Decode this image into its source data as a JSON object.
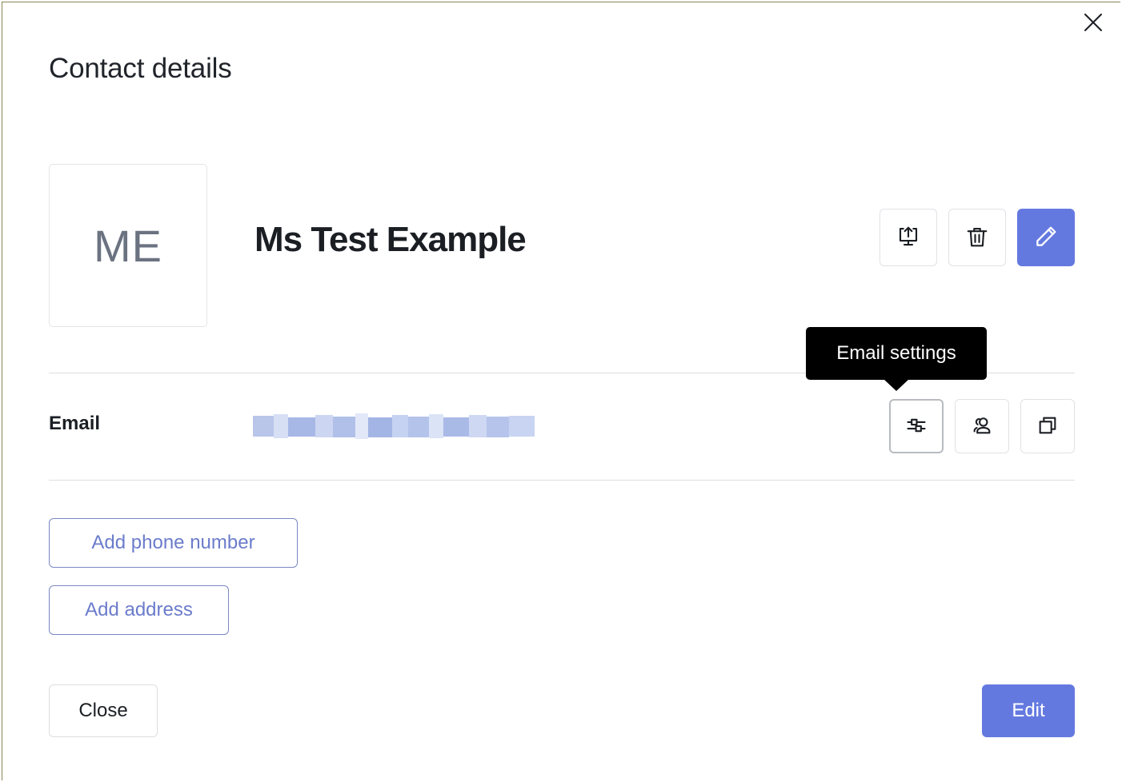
{
  "window": {
    "close_icon": "close-x-icon",
    "frame_color": "#8a8354"
  },
  "dialog": {
    "title": "Contact details"
  },
  "contact": {
    "avatar_initials": "ME",
    "name": "Ms Test Example",
    "actions": [
      {
        "name": "export-button",
        "icon": "export-monitor-upload-icon",
        "style": "outline"
      },
      {
        "name": "delete-button",
        "icon": "trash-icon",
        "style": "outline"
      },
      {
        "name": "edit-button",
        "icon": "pencil-icon",
        "style": "primary",
        "color": "#6479e0"
      }
    ]
  },
  "tooltip": {
    "text": "Email settings",
    "background": "#000000",
    "color": "#ffffff"
  },
  "fields": [
    {
      "label": "Email",
      "value": "",
      "redacted": true,
      "actions": [
        {
          "name": "email-settings-button",
          "icon": "sliders-settings-icon",
          "hovered": true
        },
        {
          "name": "email-contacts-button",
          "icon": "users-icon",
          "hovered": false
        },
        {
          "name": "email-copy-button",
          "icon": "copy-icon",
          "hovered": false
        }
      ]
    }
  ],
  "add_actions": [
    {
      "label": "Add phone number",
      "name": "add-phone-number-button"
    },
    {
      "label": "Add address",
      "name": "add-address-button"
    }
  ],
  "footer": {
    "close_label": "Close",
    "edit_label": "Edit",
    "edit_color": "#6479e0"
  },
  "colors": {
    "accent": "#6479e0",
    "link": "#6b7ccb",
    "text": "#1b1f24",
    "muted": "#6b7280",
    "border": "#e0e2e6",
    "divider": "#dcdee1"
  }
}
